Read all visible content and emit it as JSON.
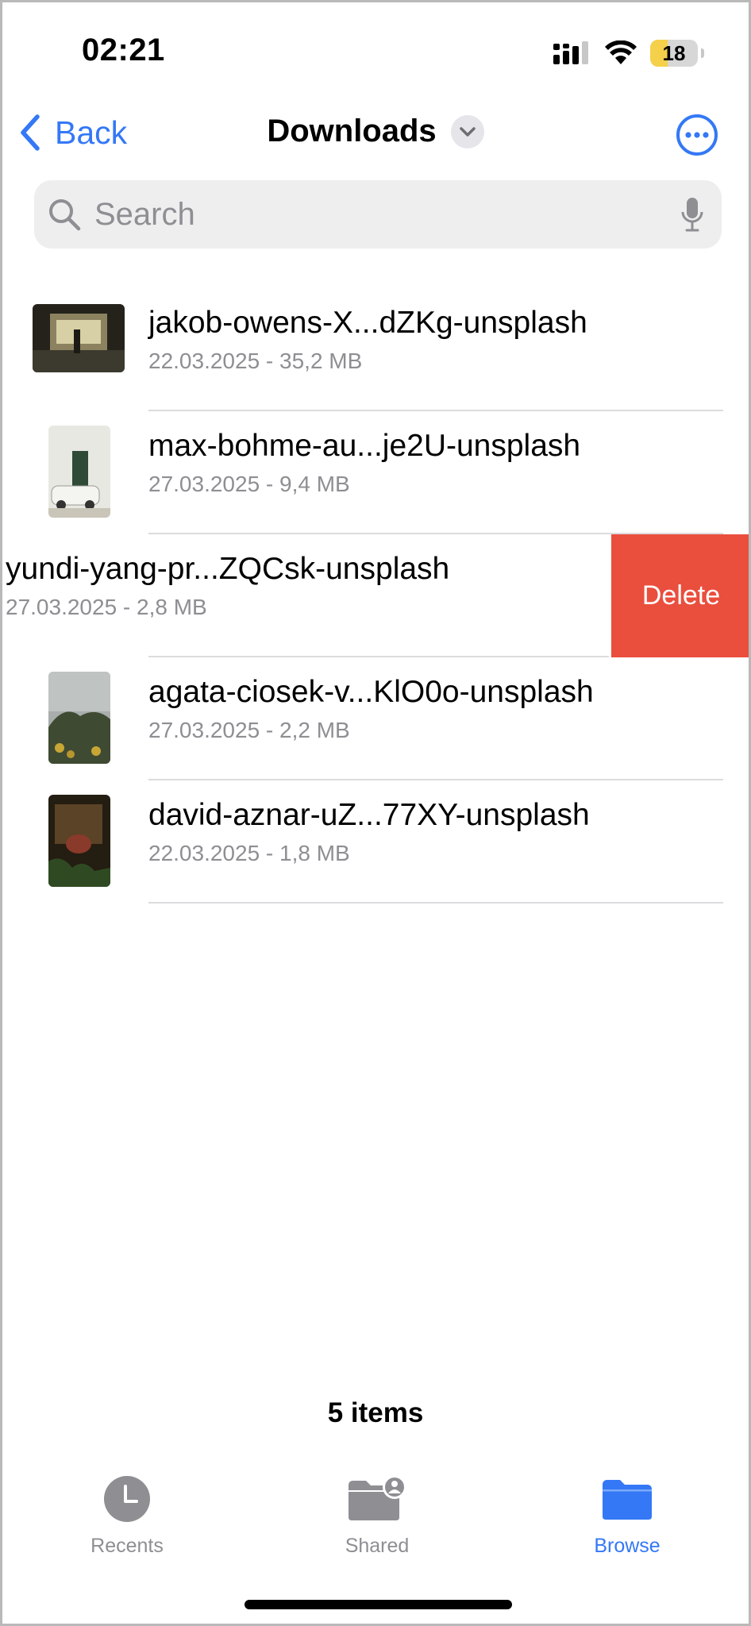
{
  "status_bar": {
    "time": "02:21",
    "battery": "18"
  },
  "nav": {
    "back_label": "Back",
    "title": "Downloads"
  },
  "search": {
    "placeholder": "Search"
  },
  "files": [
    {
      "name": "jakob-owens-X...dZKg-unsplash",
      "meta": "22.03.2025 - 35,2 MB"
    },
    {
      "name": "max-bohme-au...je2U-unsplash",
      "meta": "27.03.2025 - 9,4 MB"
    },
    {
      "name": "yundi-yang-pr...ZQCsk-unsplash",
      "meta": "27.03.2025 - 2,8 MB",
      "swiped": true
    },
    {
      "name": "agata-ciosek-v...KlO0o-unsplash",
      "meta": "27.03.2025 - 2,2 MB"
    },
    {
      "name": "david-aznar-uZ...77XY-unsplash",
      "meta": "22.03.2025 - 1,8 MB"
    }
  ],
  "swipe_action": {
    "label": "Delete",
    "color": "#ea4e3d"
  },
  "footer": {
    "item_count": "5 items"
  },
  "tabs": [
    {
      "label": "Recents",
      "icon": "clock-icon",
      "active": false
    },
    {
      "label": "Shared",
      "icon": "shared-folder-icon",
      "active": false
    },
    {
      "label": "Browse",
      "icon": "folder-icon",
      "active": true
    }
  ],
  "colors": {
    "accent": "#3478f6",
    "delete": "#ea4e3d",
    "secondary_text": "#8e8e93"
  }
}
